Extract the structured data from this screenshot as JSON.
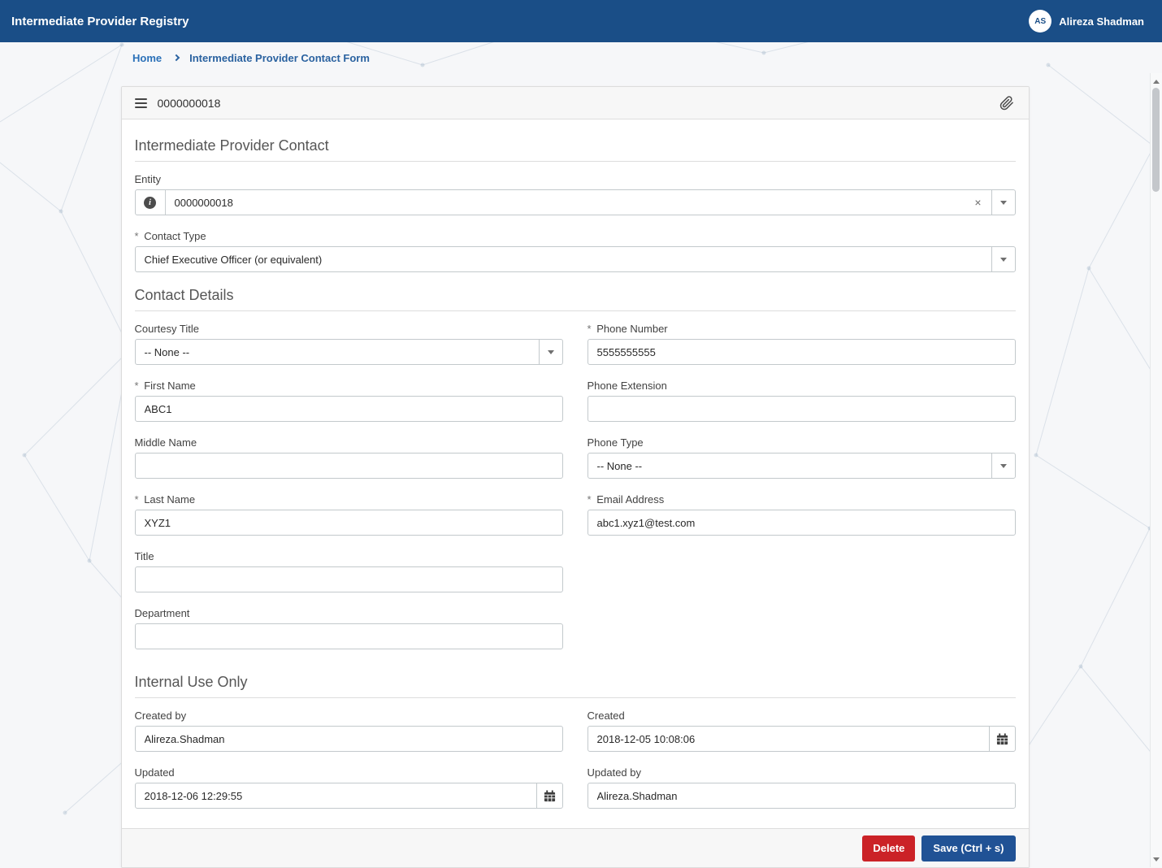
{
  "glyphs": {
    "required": "*",
    "clear": "×",
    "info": "i"
  },
  "colors": {
    "header_bg": "#1a4e87",
    "link": "#2a70b8",
    "breadcrumb_current": "#2a62a0",
    "save_button": "#205295",
    "delete_button": "#cb2227",
    "input_border": "#c3c9cc",
    "section_border": "#dddddd"
  },
  "header": {
    "app_title": "Intermediate Provider Registry",
    "user_initials": "AS",
    "user_name": "Alireza Shadman"
  },
  "breadcrumb": {
    "home": "Home",
    "current": "Intermediate Provider Contact Form"
  },
  "card": {
    "record_number": "0000000018"
  },
  "sections": {
    "contact": "Intermediate Provider Contact",
    "details": "Contact Details",
    "internal": "Internal Use Only"
  },
  "fields": {
    "entity": {
      "label": "Entity",
      "value": "0000000018",
      "required": false
    },
    "contact_type": {
      "label": "Contact Type",
      "value": "Chief Executive Officer (or equivalent)",
      "required": true
    },
    "courtesy_title": {
      "label": "Courtesy Title",
      "value": "-- None --",
      "required": false
    },
    "phone_number": {
      "label": "Phone Number",
      "value": "5555555555",
      "required": true
    },
    "first_name": {
      "label": "First Name",
      "value": "ABC1",
      "required": true
    },
    "phone_extension": {
      "label": "Phone Extension",
      "value": "",
      "required": false
    },
    "middle_name": {
      "label": "Middle Name",
      "value": "",
      "required": false
    },
    "phone_type": {
      "label": "Phone Type",
      "value": "-- None --",
      "required": false
    },
    "last_name": {
      "label": "Last Name",
      "value": "XYZ1",
      "required": true
    },
    "email": {
      "label": "Email Address",
      "value": "abc1.xyz1@test.com",
      "required": true
    },
    "title": {
      "label": "Title",
      "value": "",
      "required": false
    },
    "department": {
      "label": "Department",
      "value": "",
      "required": false
    },
    "created_by": {
      "label": "Created by",
      "value": "Alireza.Shadman",
      "required": false
    },
    "created": {
      "label": "Created",
      "value": "2018-12-05 10:08:06",
      "required": false
    },
    "updated": {
      "label": "Updated",
      "value": "2018-12-06 12:29:55",
      "required": false
    },
    "updated_by": {
      "label": "Updated by",
      "value": "Alireza.Shadman",
      "required": false
    }
  },
  "actions": {
    "delete_label": "Delete",
    "save_label": "Save (Ctrl + s)"
  }
}
